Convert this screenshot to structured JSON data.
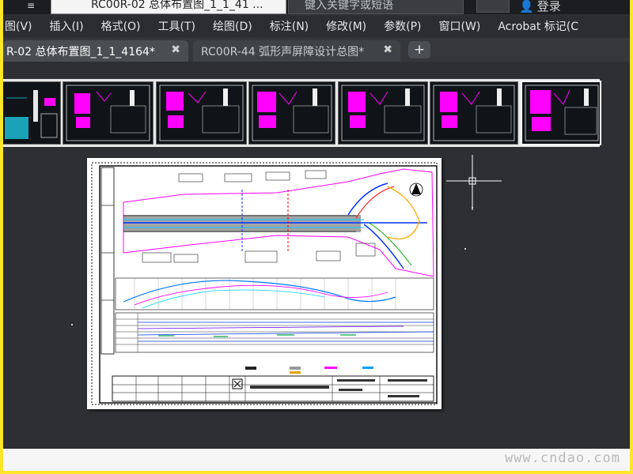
{
  "window": {
    "doc_title": "RC00R-02 总体布置图_1_1_41 ...",
    "search_placeholder": "键入关键字或短语",
    "login": "登录"
  },
  "menu": [
    "图(V)",
    "插入(I)",
    "格式(O)",
    "工具(T)",
    "绘图(D)",
    "标注(N)",
    "修改(M)",
    "参数(P)",
    "窗口(W)",
    "Acrobat 标记(C"
  ],
  "tabs": [
    {
      "label": "R-02 总体布置图_1_1_4164*",
      "close": "✖"
    },
    {
      "label": "RC00R-44 弧形声屏障设计总图*",
      "close": "✖"
    }
  ],
  "newtab_label": "+",
  "watermark": "www.cndao.com",
  "colors": {
    "background": "#2d2f33",
    "tab_active": "#4a4d52",
    "highlight_border": "#fde52a",
    "magenta": "#ff00ff"
  },
  "icons": {
    "close": "close-icon",
    "add_tab": "plus-icon",
    "user": "user-icon"
  }
}
